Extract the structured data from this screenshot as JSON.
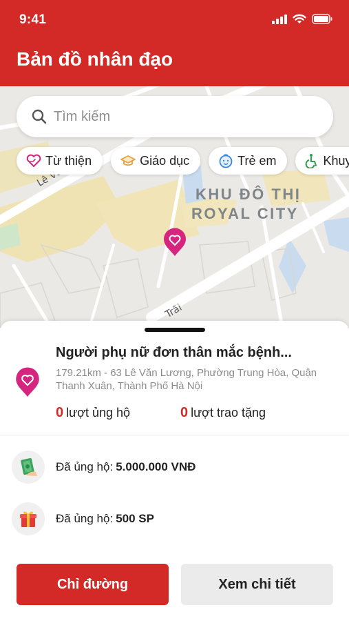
{
  "status_bar": {
    "time": "9:41"
  },
  "header": {
    "title": "Bản đồ nhân đạo"
  },
  "search": {
    "placeholder": "Tìm kiếm"
  },
  "categories": [
    {
      "label": "Từ thiện",
      "icon": "heart-hands-icon",
      "color": "#d6257f"
    },
    {
      "label": "Giáo dục",
      "icon": "graduation-cap-icon",
      "color": "#e3a23b"
    },
    {
      "label": "Trẻ em",
      "icon": "child-face-icon",
      "color": "#3a86d8"
    },
    {
      "label": "Khuyết",
      "icon": "wheelchair-icon",
      "color": "#2f9e4f"
    }
  ],
  "map": {
    "area_label_line1": "KHU ĐÔ THỊ",
    "area_label_line2": "ROYAL CITY",
    "street_label_1": "Lê Văn",
    "street_label_2": "Trãi"
  },
  "place": {
    "title": "Người phụ nữ đơn thân mắc bệnh...",
    "address": "179.21km - 63 Lê Văn Lương, Phường Trung Hòa, Quận Thanh Xuân, Thành Phố Hà Nội",
    "support_count": "0",
    "support_label": "lượt ủng hộ",
    "donate_count": "0",
    "donate_label": "lượt trao tặng"
  },
  "donations": {
    "money_label": "Đã ủng hộ:",
    "money_value": "5.000.000 VNĐ",
    "goods_label": "Đã ủng hộ:",
    "goods_value": "500 SP"
  },
  "actions": {
    "directions": "Chỉ đường",
    "details": "Xem chi tiết"
  },
  "colors": {
    "primary": "#d42a27",
    "pin": "#d6257f"
  }
}
